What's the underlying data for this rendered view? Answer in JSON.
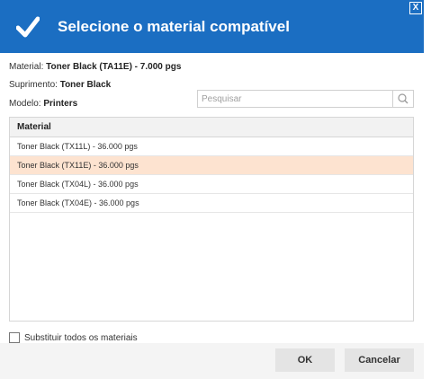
{
  "dialog": {
    "title": "Selecione o material compatível",
    "close_label": "X"
  },
  "info": {
    "material_label": "Material:",
    "material_value": "Toner Black (TA11E) - 7.000 pgs",
    "supply_label": "Suprimento:",
    "supply_value": "Toner Black",
    "model_label": "Modelo:",
    "model_value": "Printers"
  },
  "search": {
    "placeholder": "Pesquisar",
    "value": ""
  },
  "table": {
    "header": "Material",
    "rows": [
      "Toner Black (TX11L) - 36.000 pgs",
      "Toner Black (TX11E) - 36.000 pgs",
      "Toner Black (TX04L) - 36.000 pgs",
      "Toner Black (TX04E) - 36.000 pgs"
    ],
    "selected_index": 1
  },
  "replace_all": {
    "label": "Substituir todos os materiais",
    "checked": false
  },
  "buttons": {
    "ok": "OK",
    "cancel": "Cancelar"
  },
  "colors": {
    "header_bg": "#1b6ec2",
    "selected_row_bg": "#fde3d0"
  }
}
